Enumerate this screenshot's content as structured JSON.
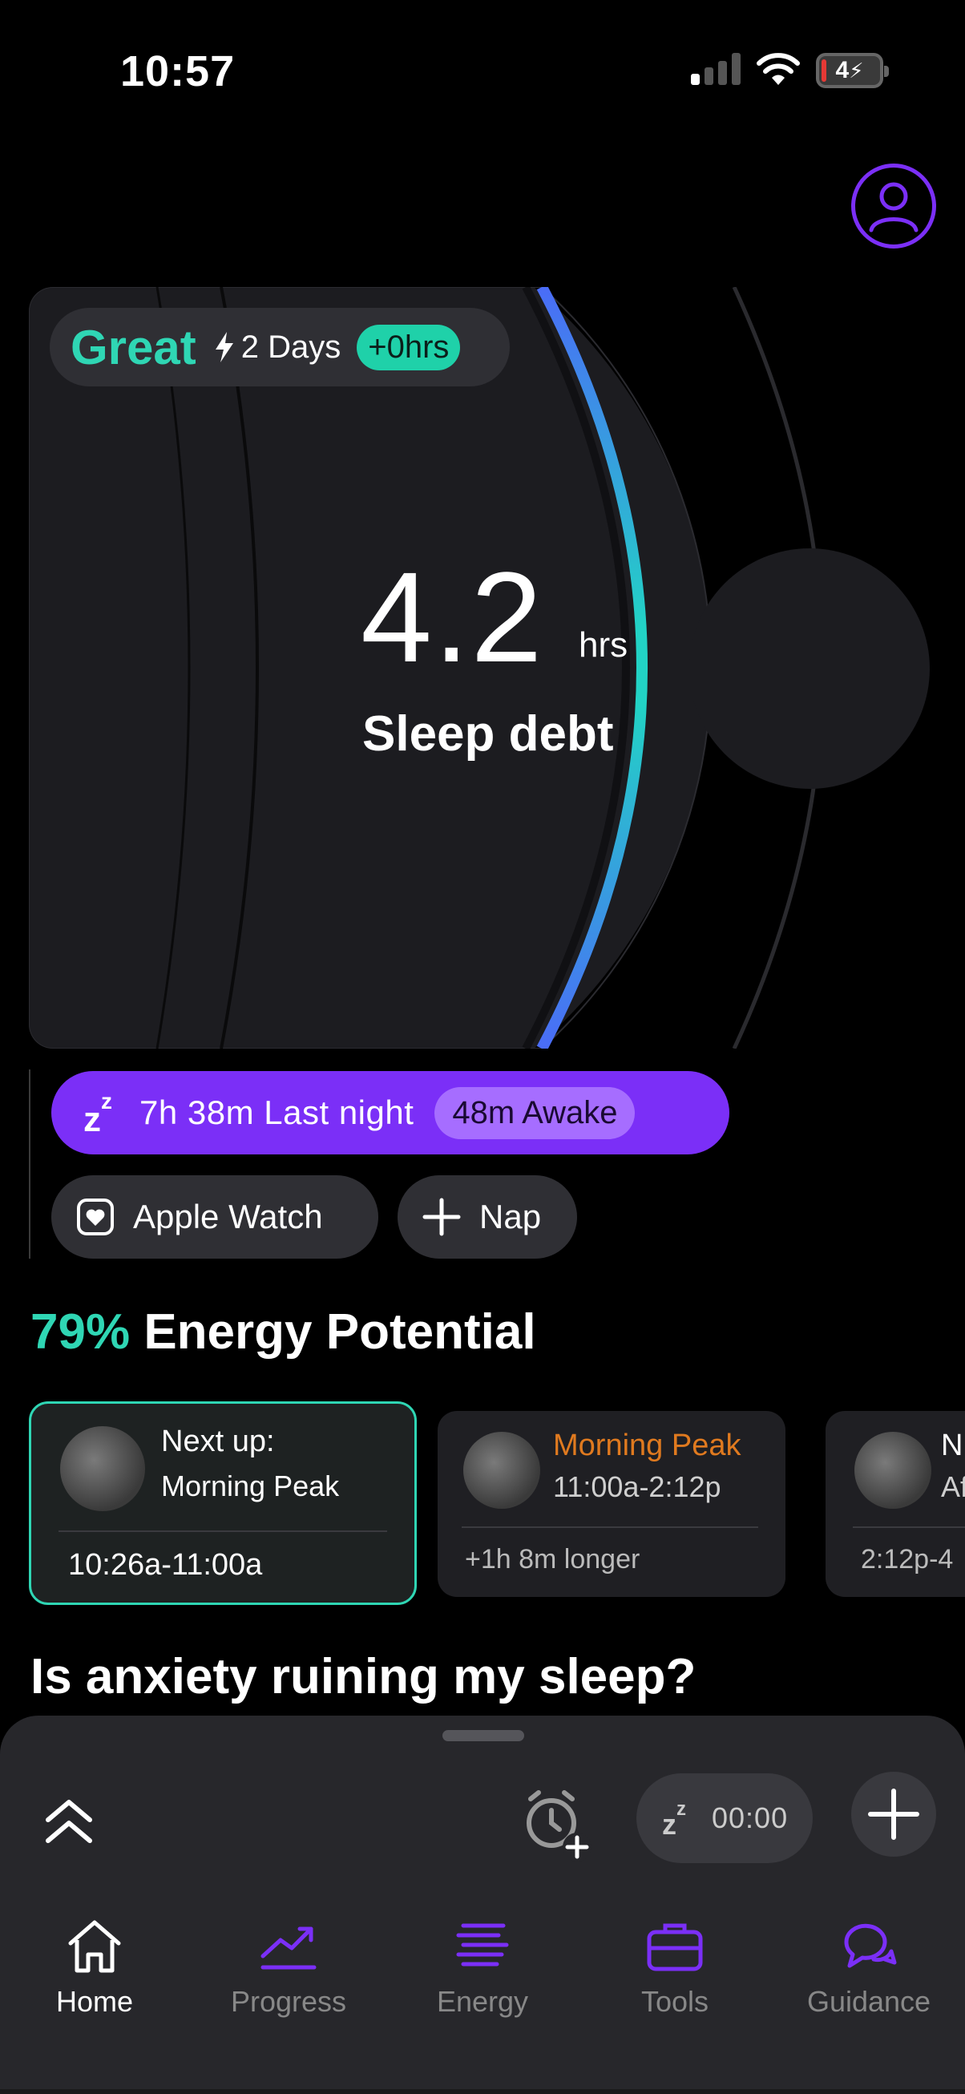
{
  "status_bar": {
    "time": "10:57",
    "battery": "4"
  },
  "streak": {
    "label": "Great",
    "days": "2 Days",
    "badge": "+0hrs"
  },
  "sleep_debt": {
    "value": "4.2",
    "unit": "hrs",
    "label": "Sleep debt"
  },
  "last_night": {
    "text": "7h 38m Last night",
    "awake": "48m Awake"
  },
  "chips": {
    "watch": "Apple Watch",
    "nap": "Nap"
  },
  "energy": {
    "percent": "79%",
    "title": "Energy Potential"
  },
  "energy_cards": [
    {
      "title": "Next up:",
      "subtitle": "Morning Peak",
      "footer": "10:26a-11:00a"
    },
    {
      "title": "Morning Peak",
      "subtitle": "11:00a-2:12p",
      "footer": "+1h 8m longer"
    },
    {
      "title": "N",
      "subtitle": "Af",
      "footer": "2:12p-4"
    }
  ],
  "article": {
    "title": "Is anxiety ruining my sleep?"
  },
  "timer": {
    "value": "00:00"
  },
  "tabs": [
    {
      "label": "Home"
    },
    {
      "label": "Progress"
    },
    {
      "label": "Energy"
    },
    {
      "label": "Tools"
    },
    {
      "label": "Guidance"
    }
  ],
  "colors": {
    "accent_purple": "#7b2ff7",
    "accent_teal": "#2fd6b4",
    "peak_orange": "#e07a1f"
  }
}
